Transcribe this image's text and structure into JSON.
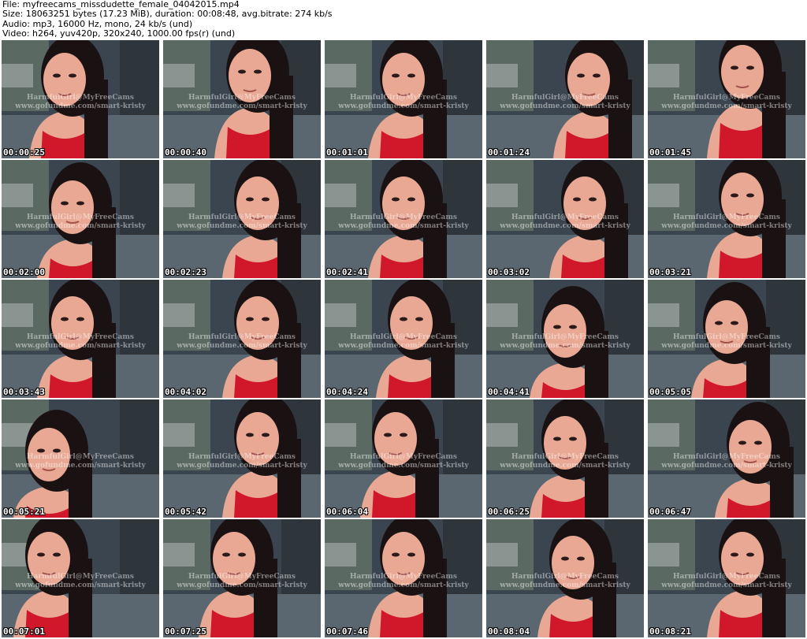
{
  "header": {
    "file_line": "File: myfreecams_missdudette_female_04042015.mp4",
    "size_line": "Size: 18063251 bytes (17.23 MiB), duration: 00:08:48, avg.bitrate: 274 kb/s",
    "audio_line": "Audio: mp3, 16000 Hz, mono, 24 kb/s (und)",
    "video_line": "Video: h264, yuv420p, 320x240, 1000.00 fps(r) (und)"
  },
  "watermark": {
    "line1": "HarmfulGirl@MyFreeCams",
    "line2": "www.gofundme.com/smart-kristy"
  },
  "colors": {
    "top_red": "#d0182a",
    "skin": "#e8a894",
    "hair": "#1a1212",
    "room": "#3a4550",
    "floor": "#5b6770"
  },
  "thumbnails": [
    {
      "timestamp": "00:00:25"
    },
    {
      "timestamp": "00:00:40"
    },
    {
      "timestamp": "00:01:01"
    },
    {
      "timestamp": "00:01:24"
    },
    {
      "timestamp": "00:01:45"
    },
    {
      "timestamp": "00:02:00"
    },
    {
      "timestamp": "00:02:23"
    },
    {
      "timestamp": "00:02:41"
    },
    {
      "timestamp": "00:03:02"
    },
    {
      "timestamp": "00:03:21"
    },
    {
      "timestamp": "00:03:43"
    },
    {
      "timestamp": "00:04:02"
    },
    {
      "timestamp": "00:04:24"
    },
    {
      "timestamp": "00:04:41"
    },
    {
      "timestamp": "00:05:05"
    },
    {
      "timestamp": "00:05:21"
    },
    {
      "timestamp": "00:05:42"
    },
    {
      "timestamp": "00:06:04"
    },
    {
      "timestamp": "00:06:25"
    },
    {
      "timestamp": "00:06:47"
    },
    {
      "timestamp": "00:07:01"
    },
    {
      "timestamp": "00:07:25"
    },
    {
      "timestamp": "00:07:46"
    },
    {
      "timestamp": "00:08:04"
    },
    {
      "timestamp": "00:08:21"
    }
  ]
}
